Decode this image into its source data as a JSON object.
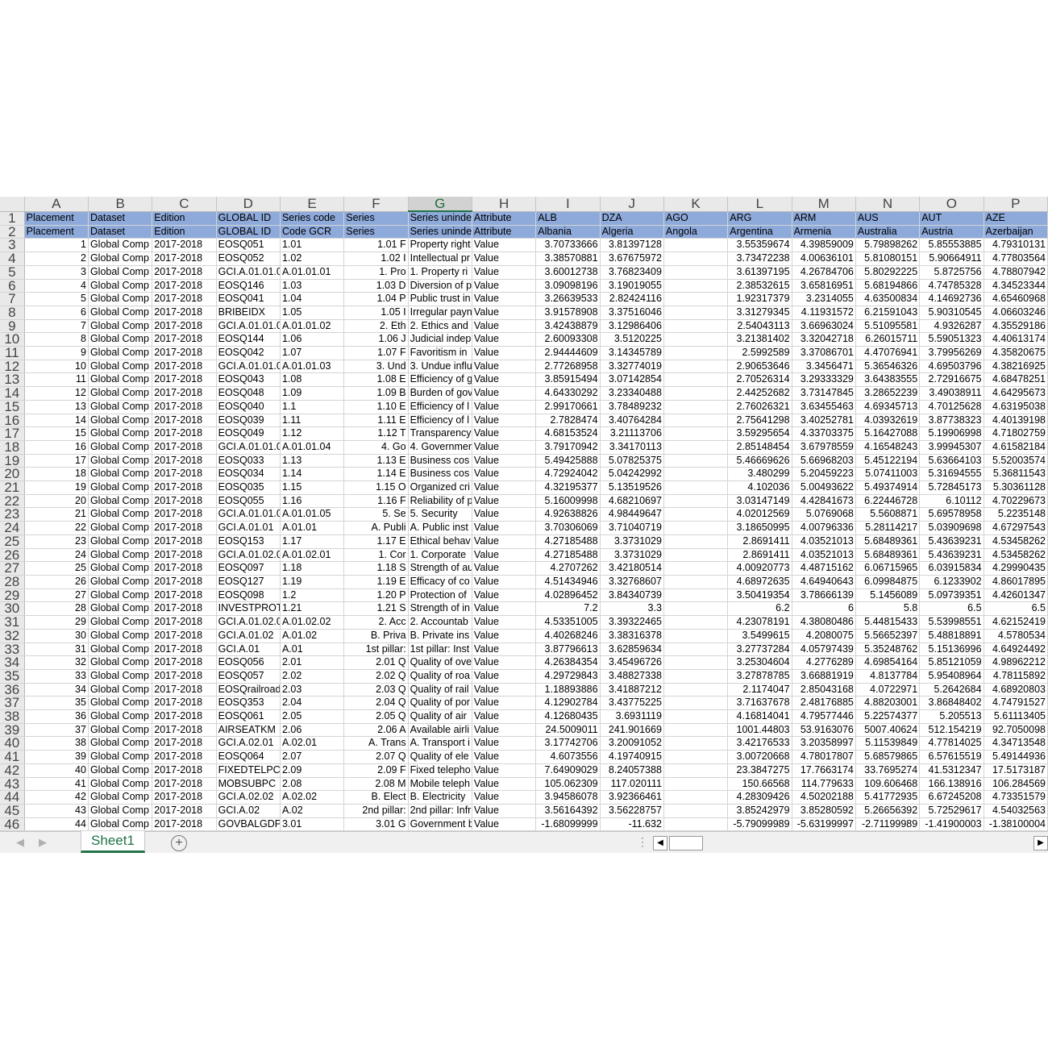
{
  "columns": [
    "A",
    "B",
    "C",
    "D",
    "E",
    "F",
    "G",
    "H",
    "I",
    "J",
    "K",
    "L",
    "M",
    "N",
    "O",
    "P"
  ],
  "selected_column": "G",
  "colors": {
    "header_fill": "#8eaadb",
    "accent": "#217346"
  },
  "header_rows": [
    [
      "Placement",
      "Dataset",
      "Edition",
      "GLOBAL ID",
      "Series code",
      "Series",
      "Series uninde",
      "Attribute",
      "ALB",
      "DZA",
      "AGO",
      "ARG",
      "ARM",
      "AUS",
      "AUT",
      "AZE"
    ],
    [
      "Placement",
      "Dataset",
      "Edition",
      "GLOBAL ID",
      "Code GCR",
      "Series",
      "Series uninde",
      "Attribute",
      "Albania",
      "Algeria",
      "Angola",
      "Argentina",
      "Armenia",
      "Australia",
      "Austria",
      "Azerbaijan"
    ]
  ],
  "rows": [
    [
      "1",
      "Global Comp",
      "2017-2018",
      "EOSQ051",
      "1.01",
      "1.01 F",
      "Property right",
      "Value",
      "3.70733666",
      "3.81397128",
      "",
      "3.55359674",
      "4.39859009",
      "5.79898262",
      "5.85553885",
      "4.79310131"
    ],
    [
      "2",
      "Global Comp",
      "2017-2018",
      "EOSQ052",
      "1.02",
      "1.02 I",
      "Intellectual pr",
      "Value",
      "3.38570881",
      "3.67675972",
      "",
      "3.73472238",
      "4.00636101",
      "5.81080151",
      "5.90664911",
      "4.77803564"
    ],
    [
      "3",
      "Global Comp",
      "2017-2018",
      "GCI.A.01.01.0",
      "A.01.01.01",
      "1. Pro",
      "1. Property ri",
      "Value",
      "3.60012738",
      "3.76823409",
      "",
      "3.61397195",
      "4.26784706",
      "5.80292225",
      "5.8725756",
      "4.78807942"
    ],
    [
      "4",
      "Global Comp",
      "2017-2018",
      "EOSQ146",
      "1.03",
      "1.03 D",
      "Diversion of p",
      "Value",
      "3.09098196",
      "3.19019055",
      "",
      "2.38532615",
      "3.65816951",
      "5.68194866",
      "4.74785328",
      "4.34523344"
    ],
    [
      "5",
      "Global Comp",
      "2017-2018",
      "EOSQ041",
      "1.04",
      "1.04 P",
      "Public trust in",
      "Value",
      "3.26639533",
      "2.82424116",
      "",
      "1.92317379",
      "3.2314055",
      "4.63500834",
      "4.14692736",
      "4.65460968"
    ],
    [
      "6",
      "Global Comp",
      "2017-2018",
      "BRIBEIDX",
      "1.05",
      "1.05 I",
      "Irregular payn",
      "Value",
      "3.91578908",
      "3.37516046",
      "",
      "3.31279345",
      "4.11931572",
      "6.21591043",
      "5.90310545",
      "4.06603246"
    ],
    [
      "7",
      "Global Comp",
      "2017-2018",
      "GCI.A.01.01.0",
      "A.01.01.02",
      "2. Eth",
      "2. Ethics and",
      "Value",
      "3.42438879",
      "3.12986406",
      "",
      "2.54043113",
      "3.66963024",
      "5.51095581",
      "4.9326287",
      "4.35529186"
    ],
    [
      "8",
      "Global Comp",
      "2017-2018",
      "EOSQ144",
      "1.06",
      "1.06 J",
      "Judicial indep",
      "Value",
      "2.60093308",
      "3.5120225",
      "",
      "3.21381402",
      "3.32042718",
      "6.26015711",
      "5.59051323",
      "4.40613174"
    ],
    [
      "9",
      "Global Comp",
      "2017-2018",
      "EOSQ042",
      "1.07",
      "1.07 F",
      "Favoritism in",
      "Value",
      "2.94444609",
      "3.14345789",
      "",
      "2.5992589",
      "3.37086701",
      "4.47076941",
      "3.79956269",
      "4.35820675"
    ],
    [
      "10",
      "Global Comp",
      "2017-2018",
      "GCI.A.01.01.0",
      "A.01.01.03",
      "3. Und",
      "3. Undue influ",
      "Value",
      "2.77268958",
      "3.32774019",
      "",
      "2.90653646",
      "3.3456471",
      "5.36546326",
      "4.69503796",
      "4.38216925"
    ],
    [
      "11",
      "Global Comp",
      "2017-2018",
      "EOSQ043",
      "1.08",
      "1.08 E",
      "Efficiency of g",
      "Value",
      "3.85915494",
      "3.07142854",
      "",
      "2.70526314",
      "3.29333329",
      "3.64383555",
      "2.72916675",
      "4.68478251"
    ],
    [
      "12",
      "Global Comp",
      "2017-2018",
      "EOSQ048",
      "1.09",
      "1.09 B",
      "Burden of gov",
      "Value",
      "4.64330292",
      "3.23340488",
      "",
      "2.44252682",
      "3.73147845",
      "3.28652239",
      "3.49038911",
      "4.64295673"
    ],
    [
      "13",
      "Global Comp",
      "2017-2018",
      "EOSQ040",
      "1.1",
      "1.10 E",
      "Efficiency of l",
      "Value",
      "2.99170661",
      "3.78489232",
      "",
      "2.76026321",
      "3.63455463",
      "4.69345713",
      "4.70125628",
      "4.63195038"
    ],
    [
      "14",
      "Global Comp",
      "2017-2018",
      "EOSQ039",
      "1.11",
      "1.11 E",
      "Efficiency of l",
      "Value",
      "2.7828474",
      "3.40764284",
      "",
      "2.75641298",
      "3.40252781",
      "4.03932619",
      "3.87738323",
      "4.40139198"
    ],
    [
      "15",
      "Global Comp",
      "2017-2018",
      "EOSQ049",
      "1.12",
      "1.12 T",
      "Transparency",
      "Value",
      "4.68153524",
      "3.21113706",
      "",
      "3.59295654",
      "4.33703375",
      "5.16427088",
      "5.19906998",
      "4.71802759"
    ],
    [
      "16",
      "Global Comp",
      "2017-2018",
      "GCI.A.01.01.0",
      "A.01.01.04",
      "4. Go",
      "4. Governmen",
      "Value",
      "3.79170942",
      "3.34170113",
      "",
      "2.85148454",
      "3.67978559",
      "4.16548243",
      "3.99945307",
      "4.61582184"
    ],
    [
      "17",
      "Global Comp",
      "2017-2018",
      "EOSQ033",
      "1.13",
      "1.13 E",
      "Business cos",
      "Value",
      "5.49425888",
      "5.07825375",
      "",
      "5.46669626",
      "5.66968203",
      "5.45122194",
      "5.63664103",
      "5.52003574"
    ],
    [
      "18",
      "Global Comp",
      "2017-2018",
      "EOSQ034",
      "1.14",
      "1.14 E",
      "Business cos",
      "Value",
      "4.72924042",
      "5.04242992",
      "",
      "3.480299",
      "5.20459223",
      "5.07411003",
      "5.31694555",
      "5.36811543"
    ],
    [
      "19",
      "Global Comp",
      "2017-2018",
      "EOSQ035",
      "1.15",
      "1.15 O",
      "Organized cri",
      "Value",
      "4.32195377",
      "5.13519526",
      "",
      "4.102036",
      "5.00493622",
      "5.49374914",
      "5.72845173",
      "5.30361128"
    ],
    [
      "20",
      "Global Comp",
      "2017-2018",
      "EOSQ055",
      "1.16",
      "1.16 F",
      "Reliability of p",
      "Value",
      "5.16009998",
      "4.68210697",
      "",
      "3.03147149",
      "4.42841673",
      "6.22446728",
      "6.10112",
      "4.70229673"
    ],
    [
      "21",
      "Global Comp",
      "2017-2018",
      "GCI.A.01.01.0",
      "A.01.01.05",
      "5. Se",
      "5. Security",
      "Value",
      "4.92638826",
      "4.98449647",
      "",
      "4.02012569",
      "5.0769068",
      "5.5608871",
      "5.69578958",
      "5.2235148"
    ],
    [
      "22",
      "Global Comp",
      "2017-2018",
      "GCI.A.01.01",
      "A.01.01",
      "A. Publi",
      "A. Public inst",
      "Value",
      "3.70306069",
      "3.71040719",
      "",
      "3.18650995",
      "4.00796336",
      "5.28114217",
      "5.03909698",
      "4.67297543"
    ],
    [
      "23",
      "Global Comp",
      "2017-2018",
      "EOSQ153",
      "1.17",
      "1.17 E",
      "Ethical behav",
      "Value",
      "4.27185488",
      "3.3731029",
      "",
      "2.8691411",
      "4.03521013",
      "5.68489361",
      "5.43639231",
      "4.53458262"
    ],
    [
      "24",
      "Global Comp",
      "2017-2018",
      "GCI.A.01.02.0",
      "A.01.02.01",
      "1. Cor",
      "1. Corporate",
      "Value",
      "4.27185488",
      "3.3731029",
      "",
      "2.8691411",
      "4.03521013",
      "5.68489361",
      "5.43639231",
      "4.53458262"
    ],
    [
      "25",
      "Global Comp",
      "2017-2018",
      "EOSQ097",
      "1.18",
      "1.18 S",
      "Strength of au",
      "Value",
      "4.2707262",
      "3.42180514",
      "",
      "4.00920773",
      "4.48715162",
      "6.06715965",
      "6.03915834",
      "4.29990435"
    ],
    [
      "26",
      "Global Comp",
      "2017-2018",
      "EOSQ127",
      "1.19",
      "1.19 E",
      "Efficacy of co",
      "Value",
      "4.51434946",
      "3.32768607",
      "",
      "4.68972635",
      "4.64940643",
      "6.09984875",
      "6.1233902",
      "4.86017895"
    ],
    [
      "27",
      "Global Comp",
      "2017-2018",
      "EOSQ098",
      "1.2",
      "1.20 P",
      "Protection of",
      "Value",
      "4.02896452",
      "3.84340739",
      "",
      "3.50419354",
      "3.78666139",
      "5.1456089",
      "5.09739351",
      "4.42601347"
    ],
    [
      "28",
      "Global Comp",
      "2017-2018",
      "INVESTPROT",
      "1.21",
      "1.21 S",
      "Strength of in",
      "Value",
      "7.2",
      "3.3",
      "",
      "6.2",
      "6",
      "5.8",
      "6.5",
      "6.5"
    ],
    [
      "29",
      "Global Comp",
      "2017-2018",
      "GCI.A.01.02.0",
      "A.01.02.02",
      "2. Acc",
      "2. Accountab",
      "Value",
      "4.53351005",
      "3.39322465",
      "",
      "4.23078191",
      "4.38080486",
      "5.44815433",
      "5.53998551",
      "4.62152419"
    ],
    [
      "30",
      "Global Comp",
      "2017-2018",
      "GCI.A.01.02",
      "A.01.02",
      "B. Priva",
      "B. Private ins",
      "Value",
      "4.40268246",
      "3.38316378",
      "",
      "3.5499615",
      "4.2080075",
      "5.56652397",
      "5.48818891",
      "4.5780534"
    ],
    [
      "31",
      "Global Comp",
      "2017-2018",
      "GCI.A.01",
      "A.01",
      "1st pillar:",
      "1st pillar: Inst",
      "Value",
      "3.87796613",
      "3.62859634",
      "",
      "3.27737284",
      "4.05797439",
      "5.35248762",
      "5.15136996",
      "4.64924492"
    ],
    [
      "32",
      "Global Comp",
      "2017-2018",
      "EOSQ056",
      "2.01",
      "2.01 Q",
      "Quality of ove",
      "Value",
      "4.26384354",
      "3.45496726",
      "",
      "3.25304604",
      "4.2776289",
      "4.69854164",
      "5.85121059",
      "4.98962212"
    ],
    [
      "33",
      "Global Comp",
      "2017-2018",
      "EOSQ057",
      "2.02",
      "2.02 Q",
      "Quality of roa",
      "Value",
      "4.29729843",
      "3.48827338",
      "",
      "3.27878785",
      "3.66881919",
      "4.8137784",
      "5.95408964",
      "4.78115892"
    ],
    [
      "34",
      "Global Comp",
      "2017-2018",
      "EOSQrailroad",
      "2.03",
      "2.03 Q",
      "Quality of rail",
      "Value",
      "1.18893886",
      "3.41887212",
      "",
      "2.1174047",
      "2.85043168",
      "4.0722971",
      "5.2642684",
      "4.68920803"
    ],
    [
      "35",
      "Global Comp",
      "2017-2018",
      "EOSQ353",
      "2.04",
      "2.04 Q",
      "Quality of por",
      "Value",
      "4.12902784",
      "3.43775225",
      "",
      "3.71637678",
      "2.48176885",
      "4.88203001",
      "3.86848402",
      "4.74791527"
    ],
    [
      "36",
      "Global Comp",
      "2017-2018",
      "EOSQ061",
      "2.05",
      "2.05 Q",
      "Quality of air",
      "Value",
      "4.12680435",
      "3.6931119",
      "",
      "4.16814041",
      "4.79577446",
      "5.22574377",
      "5.205513",
      "5.61113405"
    ],
    [
      "37",
      "Global Comp",
      "2017-2018",
      "AIRSEATKM",
      "2.06",
      "2.06 A",
      "Available airli",
      "Value",
      "24.5009011",
      "241.901669",
      "",
      "1001.44803",
      "53.9163076",
      "5007.40624",
      "512.154219",
      "92.7050098"
    ],
    [
      "38",
      "Global Comp",
      "2017-2018",
      "GCI.A.02.01",
      "A.02.01",
      "A. Trans",
      "A. Transport i",
      "Value",
      "3.17742706",
      "3.20091052",
      "",
      "3.42176533",
      "3.20358997",
      "5.11539849",
      "4.77814025",
      "4.34713548"
    ],
    [
      "39",
      "Global Comp",
      "2017-2018",
      "EOSQ064",
      "2.07",
      "2.07 Q",
      "Quality of ele",
      "Value",
      "4.6073556",
      "4.19740915",
      "",
      "3.00720668",
      "4.78017807",
      "5.68579865",
      "6.57615519",
      "5.49144936"
    ],
    [
      "40",
      "Global Comp",
      "2017-2018",
      "FIXEDTELPC",
      "2.09",
      "2.09 F",
      "Fixed telepho",
      "Value",
      "7.64909029",
      "8.24057388",
      "",
      "23.3847275",
      "17.7663174",
      "33.7695274",
      "41.5312347",
      "17.5173187"
    ],
    [
      "41",
      "Global Comp",
      "2017-2018",
      "MOBSUBPC",
      "2.08",
      "2.08 M",
      "Mobile teleph",
      "Value",
      "105.062309",
      "117.020111",
      "",
      "150.66568",
      "114.779633",
      "109.606468",
      "166.138916",
      "106.284569"
    ],
    [
      "42",
      "Global Comp",
      "2017-2018",
      "GCI.A.02.02",
      "A.02.02",
      "B. Elect",
      "B. Electricity",
      "Value",
      "3.94586078",
      "3.92366461",
      "",
      "4.28309426",
      "4.50202188",
      "5.41772935",
      "6.67245208",
      "4.73351579"
    ],
    [
      "43",
      "Global Comp",
      "2017-2018",
      "GCI.A.02",
      "A.02",
      "2nd pillar:",
      "2nd pillar: Infr",
      "Value",
      "3.56164392",
      "3.56228757",
      "",
      "3.85242979",
      "3.85280592",
      "5.26656392",
      "5.72529617",
      "4.54032563"
    ],
    [
      "44",
      "Global Comp",
      "2017-2018",
      "GOVBALGDP",
      "3.01",
      "3.01 G",
      "Government b",
      "Value",
      "-1.68099999",
      "-11.632",
      "",
      "-5.79099989",
      "-5.63199997",
      "-2.71199989",
      "-1.41900003",
      "-1.38100004"
    ]
  ],
  "sheet_tabs": [
    "Sheet1"
  ],
  "add_sheet_label": "+"
}
